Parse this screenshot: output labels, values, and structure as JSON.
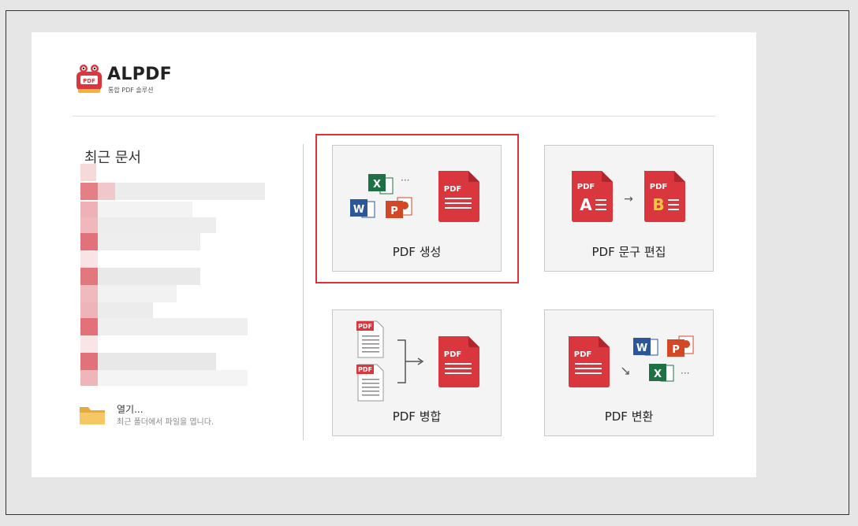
{
  "app": {
    "name": "ALPDF",
    "subtitle": "통합 PDF 솔루션"
  },
  "recent": {
    "title": "최근 문서",
    "open_label": "열기...",
    "open_desc": "최근 폴더에서 파일을 엽니다."
  },
  "cards": {
    "create": {
      "label": "PDF 생성",
      "icon_text": "PDF"
    },
    "edit": {
      "label": "PDF 문구 편집",
      "icon_text": "PDF",
      "a": "A",
      "b": "B"
    },
    "merge": {
      "label": "PDF 병합",
      "icon_text": "PDF"
    },
    "convert": {
      "label": "PDF 변환",
      "icon_text": "PDF"
    }
  },
  "icons": {
    "excel": "X",
    "word": "W",
    "ppt": "P",
    "ellipsis": "···",
    "arrow": "→"
  },
  "colors": {
    "pdf_red": "#d9363e",
    "pdf_dark": "#b0262c",
    "excel": "#1e7145",
    "word": "#2b579a",
    "ppt": "#d24726",
    "highlight": "#e0303a",
    "folder": "#f0c060"
  }
}
